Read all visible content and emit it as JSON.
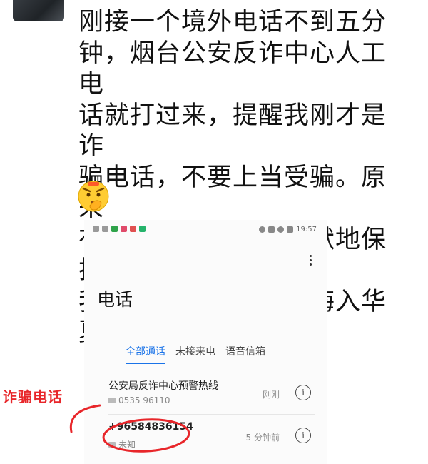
{
  "post": {
    "lines": [
      "刚接一个境外电话不到五分",
      "钟，烟台公安反诈中心人工电",
      "话就打过来，提醒我刚才是诈",
      "骗电话，不要上当受骗。原来",
      "有这么多人在幕后默默地保护",
      "我们，感恩！此生无悔入华夏"
    ],
    "emoji_icon": "shushing-face-emoji"
  },
  "phone": {
    "status_time": "19:57",
    "title": "电话",
    "tabs": [
      "全部通话",
      "未接来电",
      "语音信箱"
    ],
    "active_tab": 0,
    "calls": [
      {
        "name": "公安局反诈中心预警热线",
        "number": "0535 96110",
        "time": "刚刚"
      },
      {
        "name": "+96584836154",
        "number": "未知",
        "time": "5 分钟前"
      }
    ]
  },
  "annotation": {
    "label": "诈骗电话",
    "color": "#e8262a"
  }
}
